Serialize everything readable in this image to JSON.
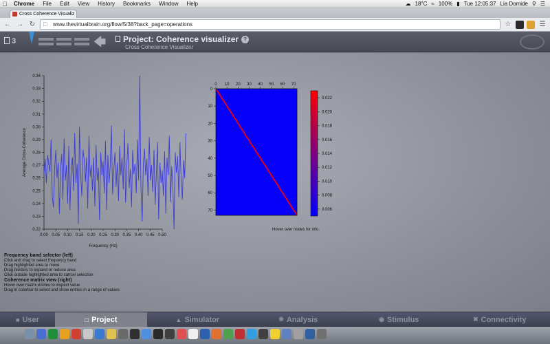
{
  "menubar": {
    "app": "Chrome",
    "menus": [
      "File",
      "Edit",
      "View",
      "History",
      "Bookmarks",
      "Window",
      "Help"
    ],
    "temperature": "18°C",
    "battery": "100%",
    "clock": "Tue 12:05:37",
    "user": "Lia Domide"
  },
  "browser": {
    "tab_title": "Cross Coherence Visualiz",
    "url": "www.thevirtualbrain.org/flow/5/38?back_page=operations"
  },
  "header": {
    "count": "3",
    "title": "Project: Coherence visualizer",
    "subtitle": "Cross Coherence Visualizer",
    "help": "?"
  },
  "chart_data": [
    {
      "type": "line",
      "title": "",
      "xlabel": "Frequency (Hz)",
      "ylabel": "Average Cross-Coherence",
      "xlim": [
        0.0,
        0.5
      ],
      "ylim": [
        0.22,
        0.34
      ],
      "xticks": [
        "0.00",
        "0.05",
        "0.10",
        "0.15",
        "0.20",
        "0.25",
        "0.30",
        "0.35",
        "0.40",
        "0.45",
        "0.50"
      ],
      "yticks": [
        "0.22",
        "0.23",
        "0.24",
        "0.25",
        "0.26",
        "0.27",
        "0.28",
        "0.29",
        "0.30",
        "0.31",
        "0.32",
        "0.33",
        "0.34"
      ],
      "color": "#3b3bd6",
      "series": [
        {
          "x_start": 0.0,
          "x_step": 0.005,
          "values": [
            0.263,
            0.275,
            0.256,
            0.278,
            0.271,
            0.265,
            0.29,
            0.245,
            0.237,
            0.268,
            0.282,
            0.26,
            0.272,
            0.232,
            0.267,
            0.279,
            0.243,
            0.291,
            0.258,
            0.27,
            0.24,
            0.285,
            0.235,
            0.269,
            0.276,
            0.25,
            0.295,
            0.256,
            0.271,
            0.224,
            0.3,
            0.263,
            0.246,
            0.282,
            0.274,
            0.257,
            0.276,
            0.236,
            0.293,
            0.261,
            0.27,
            0.25,
            0.276,
            0.238,
            0.286,
            0.258,
            0.268,
            0.227,
            0.28,
            0.262,
            0.273,
            0.248,
            0.289,
            0.235,
            0.278,
            0.256,
            0.269,
            0.301,
            0.247,
            0.266,
            0.28,
            0.253,
            0.272,
            0.242,
            0.285,
            0.262,
            0.276,
            0.251,
            0.298,
            0.241,
            0.269,
            0.287,
            0.252,
            0.267,
            0.237,
            0.282,
            0.263,
            0.271,
            0.248,
            0.29,
            0.258,
            0.34,
            0.252,
            0.226,
            0.271,
            0.283,
            0.262,
            0.275,
            0.246,
            0.292,
            0.258,
            0.27,
            0.249,
            0.282,
            0.239,
            0.263,
            0.288,
            0.228,
            0.272,
            0.256,
            0.266,
            0.246,
            0.281,
            0.232,
            0.276,
            0.262,
            0.293,
            0.241,
            0.269,
            0.252,
            0.22,
            0.28,
            0.264,
            0.277,
            0.245,
            0.288,
            0.258,
            0.243,
            0.274,
            0.26,
            0.295
          ]
        }
      ]
    },
    {
      "type": "heatmap",
      "title": "",
      "xlim": [
        0,
        73
      ],
      "ylim": [
        0,
        73
      ],
      "xticks": [
        "0",
        "10",
        "20",
        "30",
        "40",
        "50",
        "60",
        "70"
      ],
      "yticks": [
        "0",
        "10",
        "20",
        "30",
        "40",
        "50",
        "60",
        "70"
      ],
      "description_values": {
        "off_diagonal": 0.0055,
        "diagonal": 0.023
      },
      "colorbar": {
        "range": [
          0.005,
          0.023
        ],
        "ticks": [
          "0.006",
          "0.008",
          "0.010",
          "0.012",
          "0.014",
          "0.016",
          "0.018",
          "0.020",
          "0.022"
        ],
        "colors": [
          "#0000ff",
          "#ff0000"
        ]
      }
    }
  ],
  "hover_hint": "Hover over nodes for info.",
  "help": {
    "freq_heading": "Frequency band selector (left)",
    "freq_lines": [
      "Click and drag to select frequency band",
      "Drag highlighted area to move",
      "Drag borders to expand or reduce area",
      "Click outside highlighted area to cancel selection"
    ],
    "matrix_heading": "Coherence matrix view (right)",
    "matrix_lines": [
      "Hover over matrix entries to inspect value",
      "Drag in colorbar to select and show entries in a range of values"
    ]
  },
  "bottom_nav": [
    {
      "label": "User",
      "icon": "user-icon"
    },
    {
      "label": "Project",
      "icon": "project-icon"
    },
    {
      "label": "Simulator",
      "icon": "simulator-icon"
    },
    {
      "label": "Analysis",
      "icon": "analysis-icon"
    },
    {
      "label": "Stimulus",
      "icon": "stimulus-icon"
    },
    {
      "label": "Connectivity",
      "icon": "connectivity-icon"
    }
  ],
  "dock": {
    "icon_colors": [
      "#7a8fa8",
      "#4a6fd0",
      "#1f8f3a",
      "#e8a020",
      "#d04030",
      "#c8c8c8",
      "#3a7ad0",
      "#e0c050",
      "#6a6a6a",
      "#303030",
      "#5090e0",
      "#2a2a2a",
      "#404040",
      "#e05050",
      "#f0f0f0",
      "#2d5fb0",
      "#e07030",
      "#50a050",
      "#c03030",
      "#30a0e0",
      "#404040",
      "#f0d030",
      "#6080c0",
      "#a0a0a0",
      "#3060a0",
      "#707070"
    ]
  }
}
